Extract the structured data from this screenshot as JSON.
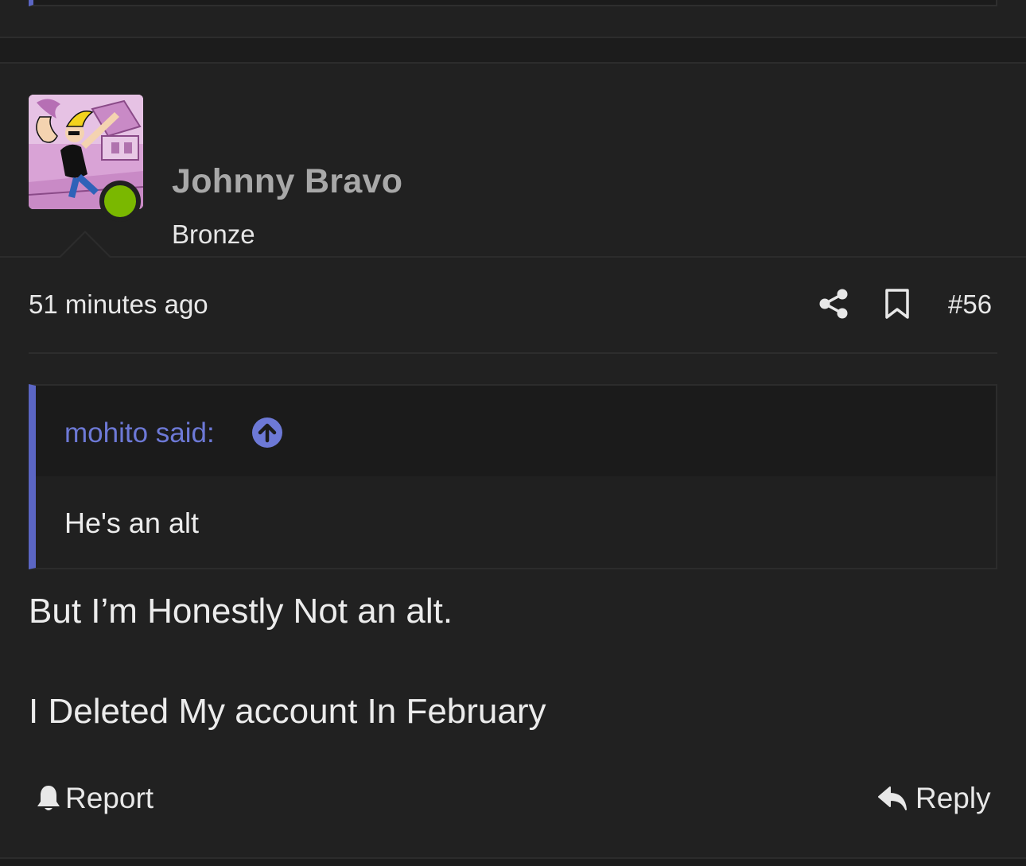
{
  "post": {
    "author": {
      "name": "Johnny Bravo",
      "title": "Bronze",
      "online": true
    },
    "timestamp": "51 minutes ago",
    "number": "#56",
    "quote": {
      "author_label": "mohito said:",
      "text": "He's an alt"
    },
    "body": [
      "But I’m Honestly Not an alt.",
      "I Deleted My account In February"
    ],
    "actions": {
      "report_label": "Report",
      "reply_label": "Reply"
    }
  },
  "colors": {
    "background": "#1c1c1c",
    "post_bg": "#212121",
    "quote_accent": "#5b66c4",
    "quote_author": "#6d79d6",
    "online": "#7ab800",
    "username": "#a8a8a8"
  },
  "icons": [
    "share-icon",
    "bookmark-icon",
    "arrow-up-circle-icon",
    "bell-icon",
    "reply-icon"
  ]
}
